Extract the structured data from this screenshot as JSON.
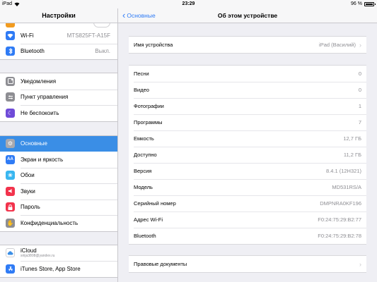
{
  "status": {
    "device": "iPad",
    "time": "23:29",
    "battery": "96 %",
    "battery_level": 0.96
  },
  "sidebar": {
    "title": "Настройки",
    "group1": [
      {
        "label": "Wi-Fi",
        "value": "MTS825FT-A15F",
        "icon": "wifi-icon",
        "color": "#2f7bf5"
      },
      {
        "label": "Bluetooth",
        "value": "Выкл.",
        "icon": "bluetooth-icon",
        "color": "#2f7bf5"
      }
    ],
    "group2": [
      {
        "label": "Уведомления",
        "icon": "notifications-icon",
        "color": "#8e8e93"
      },
      {
        "label": "Пункт управления",
        "icon": "control-center-icon",
        "color": "#8e8e93"
      },
      {
        "label": "Не беспокоить",
        "icon": "moon-icon",
        "color": "#6f4bd8"
      }
    ],
    "group3": [
      {
        "label": "Основные",
        "icon": "gear-icon",
        "color": "#8e8e93",
        "active": true
      },
      {
        "label": "Экран и яркость",
        "icon": "brightness-icon",
        "color": "#2f7bf5"
      },
      {
        "label": "Обои",
        "icon": "wallpaper-icon",
        "color": "#38b6f0"
      },
      {
        "label": "Звуки",
        "icon": "sound-icon",
        "color": "#f2334c"
      },
      {
        "label": "Пароль",
        "icon": "lock-icon",
        "color": "#f2334c"
      },
      {
        "label": "Конфиденциальность",
        "icon": "hand-icon",
        "color": "#8e8e93"
      }
    ],
    "group4": [
      {
        "label": "iCloud",
        "sub": "sriija3808@yandex.ru",
        "icon": "cloud-icon",
        "color": "#ffffff"
      },
      {
        "label": "iTunes Store, App Store",
        "icon": "app-store-icon",
        "color": "#2f7bf5"
      }
    ]
  },
  "detail": {
    "back_label": "Основные",
    "title": "Об этом устройстве",
    "device_name": {
      "label": "Имя устройства",
      "value": "iPad (Василий)"
    },
    "info": [
      {
        "label": "Песни",
        "value": "0"
      },
      {
        "label": "Видео",
        "value": "0"
      },
      {
        "label": "Фотографии",
        "value": "1"
      },
      {
        "label": "Программы",
        "value": "7"
      },
      {
        "label": "Емкость",
        "value": "12,7 ГБ"
      },
      {
        "label": "Доступно",
        "value": "11,2 ГБ"
      },
      {
        "label": "Версия",
        "value": "8.4.1 (12H321)"
      },
      {
        "label": "Модель",
        "value": "MD531RS/A"
      },
      {
        "label": "Серийный номер",
        "value": "DMPNRA0KF196"
      },
      {
        "label": "Адрес Wi-Fi",
        "value": "F0:24:75:29:B2:77"
      },
      {
        "label": "Bluetooth",
        "value": "F0:24:75:29:B2:78"
      }
    ],
    "legal_label": "Правовые документы"
  }
}
